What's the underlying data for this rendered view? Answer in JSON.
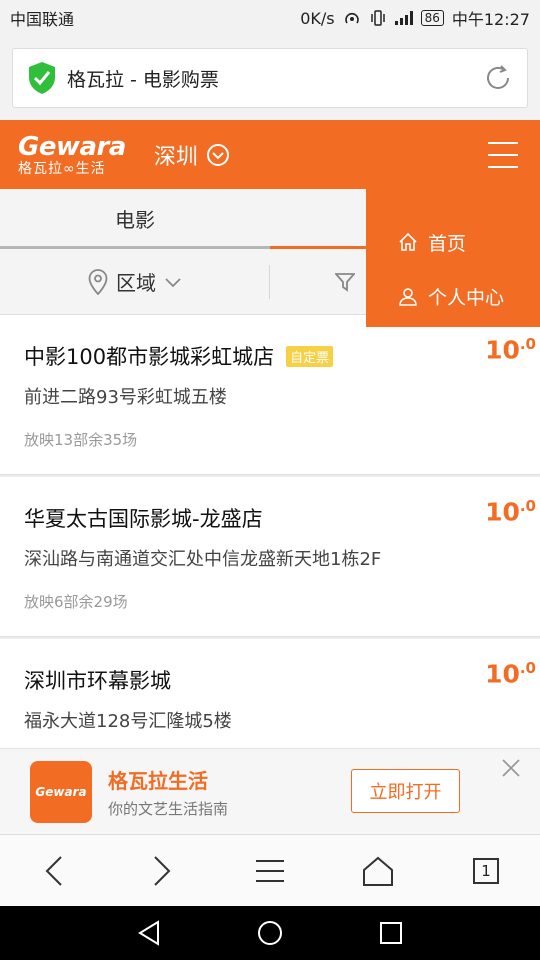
{
  "status_bar": {
    "carrier": "中国联通",
    "speed": "0K/s",
    "battery": "86",
    "time": "中午12:27"
  },
  "browser": {
    "page_title": "格瓦拉 - 电影购票",
    "tab_count": "1"
  },
  "header": {
    "logo_en": "Gewara",
    "logo_cn": "格瓦拉∞生活",
    "city": "深圳"
  },
  "tabs": [
    {
      "label": "电影"
    },
    {
      "label": ""
    }
  ],
  "filters": {
    "area_label": "区域"
  },
  "menu": {
    "items": [
      {
        "label": "首页"
      },
      {
        "label": "个人中心"
      }
    ]
  },
  "cinemas": [
    {
      "name": "中影100都市影城彩虹城店",
      "badge": "自定票",
      "address": "前进二路93号彩虹城五楼",
      "shows": "放映13部余35场",
      "price": "10",
      "price_decimal": ".0"
    },
    {
      "name": "华夏太古国际影城-龙盛店",
      "badge": "",
      "address": "深汕路与南通道交汇处中信龙盛新天地1栋2F",
      "shows": "放映6部余29场",
      "price": "10",
      "price_decimal": ".0"
    },
    {
      "name": "深圳市环幕影城",
      "badge": "",
      "address": "福永大道128号汇隆城5楼",
      "shows": "",
      "price": "10",
      "price_decimal": ".0"
    }
  ],
  "app_banner": {
    "icon_text": "Gewara",
    "title": "格瓦拉生活",
    "subtitle": "你的文艺生活指南",
    "open_label": "立即打开"
  },
  "colors": {
    "brand": "#f26c24",
    "badge": "#f7d046"
  }
}
